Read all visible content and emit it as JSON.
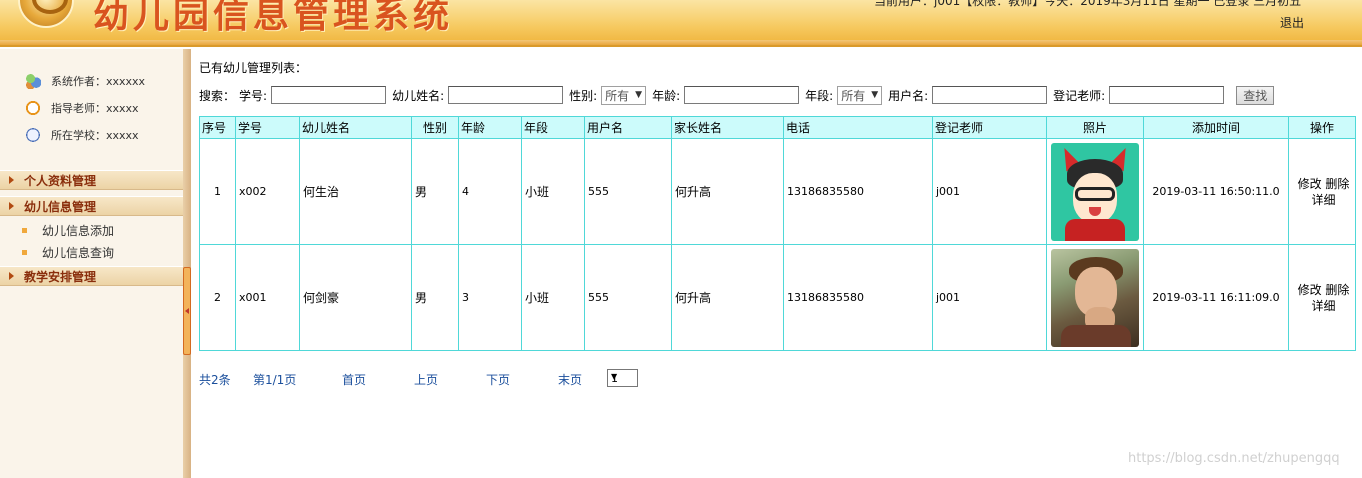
{
  "header": {
    "title": "幼儿园信息管理系统",
    "user_info": "当前用户：j001【权限：教师】今天：2019年3月11日 星期一 已登录 三月初五",
    "logout": "退出"
  },
  "sidebar": {
    "info": [
      {
        "label": "系统作者：xxxxxx",
        "icon": "users-icon"
      },
      {
        "label": "指导老师：xxxxx",
        "icon": "clock-icon"
      },
      {
        "label": "所在学校：xxxxx",
        "icon": "compass-icon"
      }
    ],
    "groups": [
      {
        "label": "个人资料管理"
      },
      {
        "label": "幼儿信息管理",
        "items": [
          "幼儿信息添加",
          "幼儿信息查询"
        ]
      },
      {
        "label": "教学安排管理"
      }
    ]
  },
  "main": {
    "list_title": "已有幼儿管理列表：",
    "search": {
      "prefix": "搜索：",
      "student_no_label": "学号:",
      "name_label": "幼儿姓名:",
      "gender_label": "性别:",
      "gender_value": "所有",
      "age_label": "年龄:",
      "grade_label": "年段:",
      "grade_value": "所有",
      "username_label": "用户名:",
      "teacher_label": "登记老师:",
      "search_button": "查找"
    },
    "table": {
      "headers": [
        "序号",
        "学号",
        "幼儿姓名",
        "性别",
        "年龄",
        "年段",
        "用户名",
        "家长姓名",
        "电话",
        "登记老师",
        "照片",
        "添加时间",
        "操作"
      ],
      "rows": [
        {
          "index": "1",
          "student_no": "x002",
          "name": "何生治",
          "gender": "男",
          "age": "4",
          "grade": "小班",
          "username": "555",
          "parent": "何升高",
          "phone": "13186835580",
          "teacher": "j001",
          "photo": "cartoon-avatar",
          "added": "2019-03-11 16:50:11.0",
          "edit": "修改",
          "delete": "删除",
          "detail": "详细"
        },
        {
          "index": "2",
          "student_no": "x001",
          "name": "何剑豪",
          "gender": "男",
          "age": "3",
          "grade": "小班",
          "username": "555",
          "parent": "何升高",
          "phone": "13186835580",
          "teacher": "j001",
          "photo": "child-photo",
          "added": "2019-03-11 16:11:09.0",
          "edit": "修改",
          "delete": "删除",
          "detail": "详细"
        }
      ]
    },
    "pager": {
      "total": "共2条",
      "page": "第1/1页",
      "first": "首页",
      "prev": "上页",
      "next": "下页",
      "last": "末页",
      "select_value": "1"
    }
  },
  "watermark": "https://blog.csdn.net/zhupengqq",
  "colors": {
    "header_bg": "#f6c95f",
    "title": "#d9541f",
    "table_border": "#4fd8d8",
    "table_header_bg": "#ccfbfb",
    "link": "#1b4f9c",
    "menu_group_text": "#8a2e0c"
  }
}
